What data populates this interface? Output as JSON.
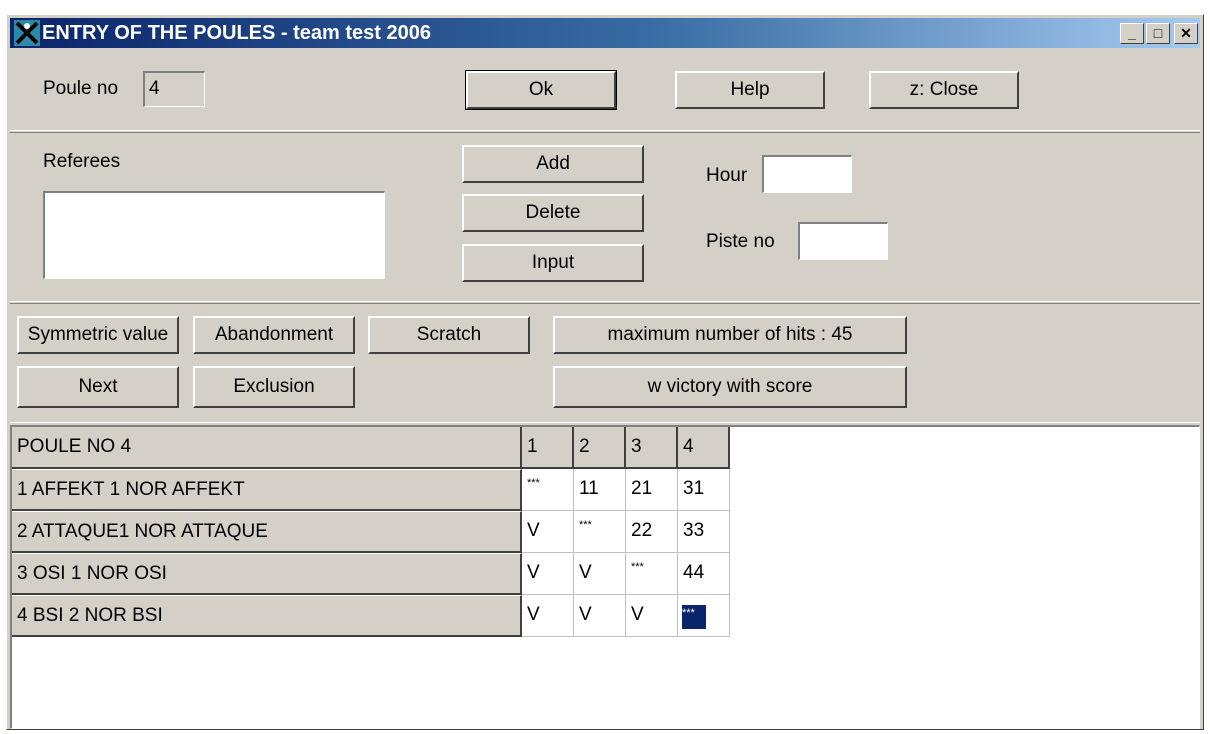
{
  "window": {
    "title": "ENTRY OF THE POULES - team test 2006",
    "controls": [
      "_",
      "□",
      "✕"
    ]
  },
  "top": {
    "poule_label": "Poule no",
    "poule_value": "4",
    "ok_label": "Ok",
    "help_label": "Help",
    "close_label": "z: Close"
  },
  "referees": {
    "label": "Referees",
    "add_label": "Add",
    "delete_label": "Delete",
    "input_label": "Input",
    "hour_label": "Hour",
    "hour_value": "",
    "piste_label": "Piste no",
    "piste_value": ""
  },
  "actions": {
    "symmetric_label": "Symmetric value",
    "abandonment_label": "Abandonment",
    "scratch_label": "Scratch",
    "max_hits_label": "maximum number of hits : 45",
    "next_label": "Next",
    "exclusion_label": "Exclusion",
    "victory_label": "w victory with score"
  },
  "poule": {
    "header": "POULE NO 4",
    "columns": [
      "1",
      "2",
      "3",
      "4"
    ],
    "rows": [
      {
        "name": "1  AFFEKT 1 NOR AFFEKT",
        "scores": [
          "***",
          "11",
          "21",
          "31"
        ]
      },
      {
        "name": "2  ATTAQUE1 NOR ATTAQUE",
        "scores": [
          "V",
          "***",
          "22",
          "33"
        ]
      },
      {
        "name": "3  OSI 1 NOR OSI",
        "scores": [
          "V",
          "V",
          "***",
          "44"
        ]
      },
      {
        "name": "4  BSI 2 NOR BSI",
        "scores": [
          "V",
          "V",
          "V",
          "***"
        ]
      }
    ]
  }
}
